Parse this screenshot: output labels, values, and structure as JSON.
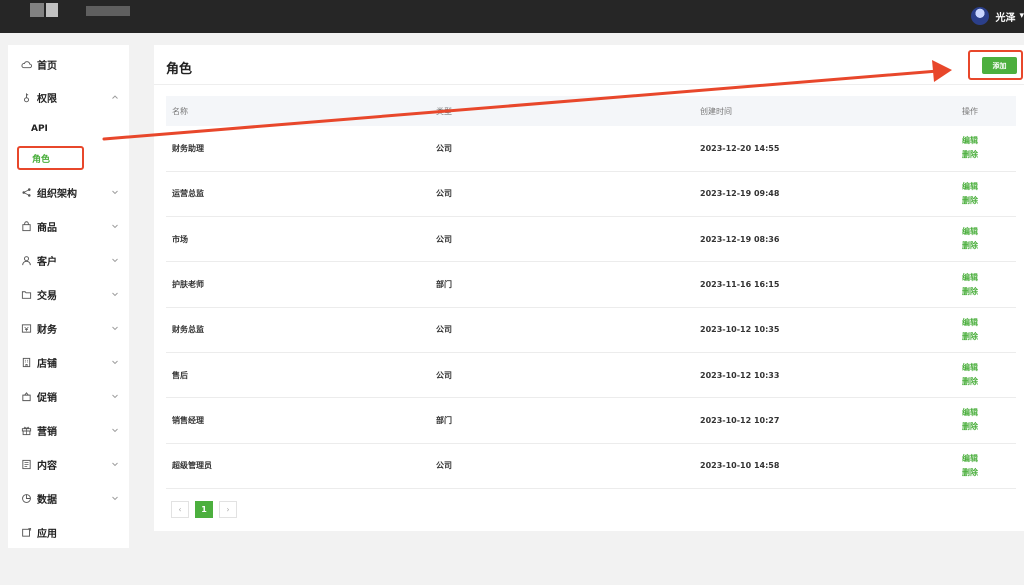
{
  "topbar": {
    "user": {
      "name": "光泽",
      "caret": "▾"
    }
  },
  "sidebar": {
    "items": [
      {
        "label": "首页",
        "icon": "cloud-icon"
      },
      {
        "label": "权限",
        "icon": "key-icon",
        "expanded": true
      },
      {
        "label": "组织架构",
        "icon": "share-icon"
      },
      {
        "label": "商品",
        "icon": "bag-icon"
      },
      {
        "label": "客户",
        "icon": "user-icon"
      },
      {
        "label": "交易",
        "icon": "folder-icon"
      },
      {
        "label": "财务",
        "icon": "finance-icon"
      },
      {
        "label": "店铺",
        "icon": "building-icon"
      },
      {
        "label": "促销",
        "icon": "tag-icon"
      },
      {
        "label": "营销",
        "icon": "gift-icon"
      },
      {
        "label": "内容",
        "icon": "document-icon"
      },
      {
        "label": "数据",
        "icon": "chart-icon"
      },
      {
        "label": "应用",
        "icon": "app-icon"
      }
    ],
    "subitems": [
      {
        "label": "API"
      },
      {
        "label": "角色",
        "active": true
      }
    ]
  },
  "main": {
    "title": "角色",
    "add_label": "添加",
    "table": {
      "headers": [
        "名称",
        "类型",
        "创建时间",
        "操作"
      ],
      "rows": [
        {
          "name": "财务助理",
          "type": "公司",
          "time": "2023-12-20 14:55"
        },
        {
          "name": "运营总监",
          "type": "公司",
          "time": "2023-12-19 09:48"
        },
        {
          "name": "市场",
          "type": "公司",
          "time": "2023-12-19 08:36"
        },
        {
          "name": "护肤老师",
          "type": "部门",
          "time": "2023-11-16 16:15"
        },
        {
          "name": "财务总监",
          "type": "公司",
          "time": "2023-10-12 10:35"
        },
        {
          "name": "售后",
          "type": "公司",
          "time": "2023-10-12 10:33"
        },
        {
          "name": "销售经理",
          "type": "部门",
          "time": "2023-10-12 10:27"
        },
        {
          "name": "超级管理员",
          "type": "公司",
          "time": "2023-10-10 14:58"
        }
      ],
      "edit_label": "编辑",
      "delete_label": "删除"
    },
    "pagination": {
      "prev": "‹",
      "current": "1",
      "next": "›"
    }
  },
  "colors": {
    "accent": "#4caf3e",
    "annotation": "#e8472b",
    "topbar": "#262626"
  }
}
